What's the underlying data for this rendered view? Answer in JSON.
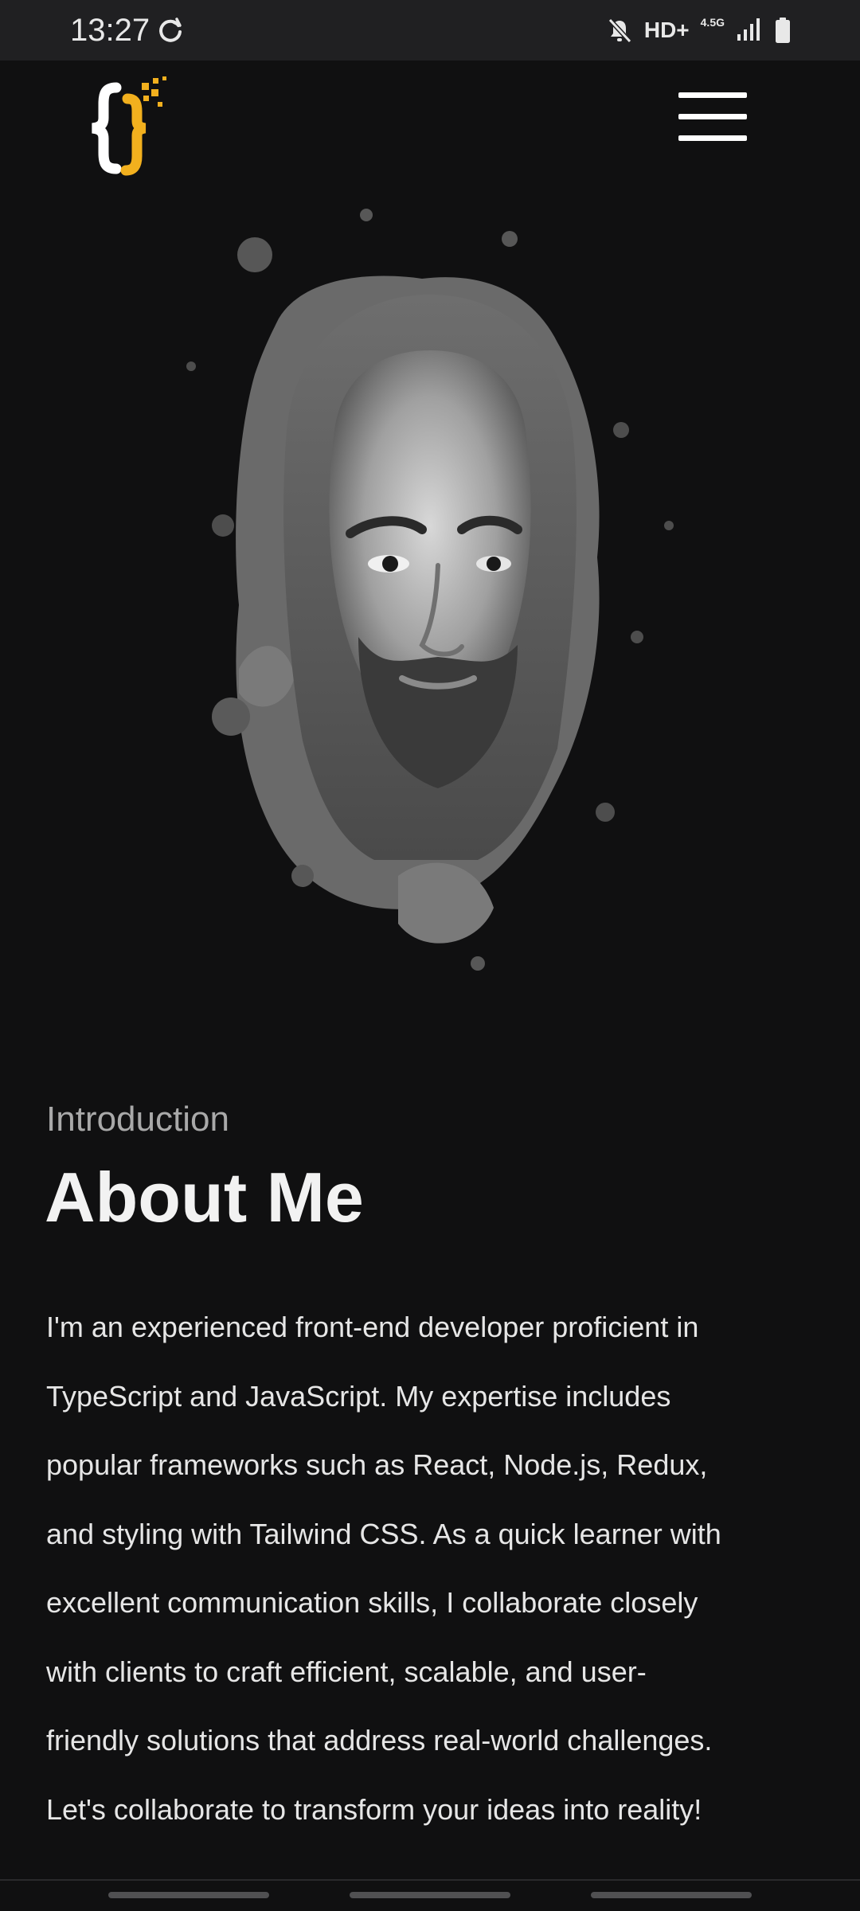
{
  "status_bar": {
    "time": "13:27",
    "network_type": "HD+",
    "network_gen": "4.5G",
    "icons": [
      "sync-icon",
      "mute-icon",
      "signal-icon",
      "battery-icon"
    ]
  },
  "header": {
    "logo_icon": "curly-braces-logo",
    "menu_icon": "hamburger-menu-icon"
  },
  "portrait": {
    "alt": "portrait"
  },
  "about": {
    "eyebrow": "Introduction",
    "title": "About Me",
    "lines": [
      "I'm an experienced front-end developer proficient in",
      "TypeScript and JavaScript. My expertise includes",
      "popular frameworks such as React, Node.js, Redux,",
      "and styling with Tailwind CSS. As a quick learner with",
      "excellent communication skills, I collaborate closely",
      "with clients to craft efficient, scalable, and user-",
      "friendly solutions that address real-world challenges.",
      "Let's collaborate to transform your ideas into reality!"
    ]
  },
  "colors": {
    "background": "#101011",
    "status_bar": "#202022",
    "accent": "#f2b01e",
    "text": "#e6e6e6",
    "muted": "#a9a9a9"
  }
}
